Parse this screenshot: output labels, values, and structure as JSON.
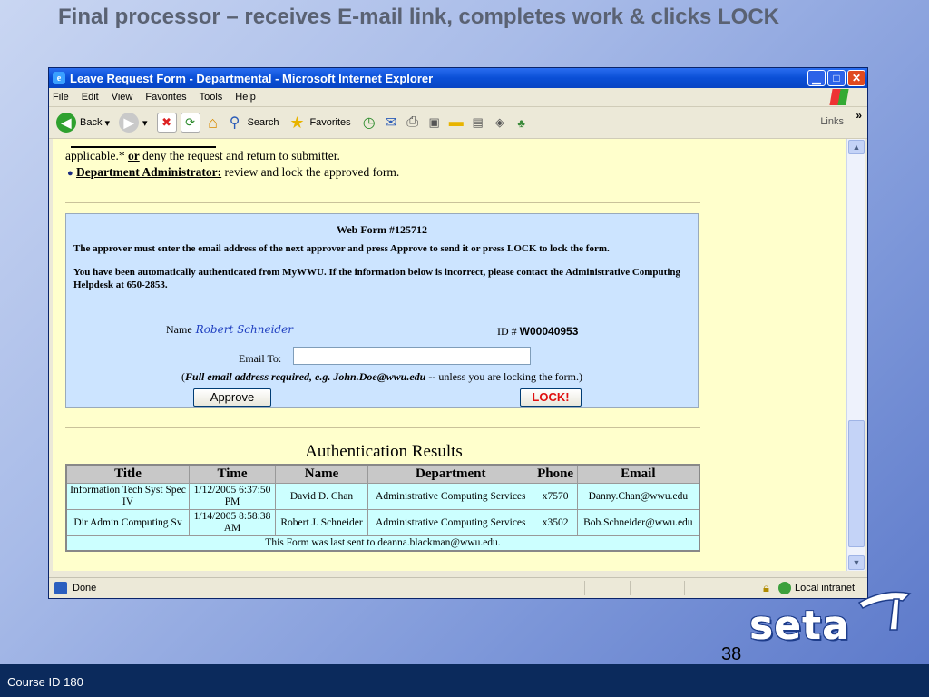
{
  "slide": {
    "title": "Final processor – receives E-mail link, completes work & clicks LOCK",
    "page_number": "38",
    "footer": "Course ID 180",
    "logo": "seta"
  },
  "window": {
    "title": "Leave Request Form - Departmental - Microsoft Internet Explorer",
    "menu": [
      "File",
      "Edit",
      "View",
      "Favorites",
      "Tools",
      "Help"
    ],
    "toolbar": {
      "back": "Back",
      "search": "Search",
      "favorites": "Favorites",
      "links": "Links"
    },
    "status": {
      "text": "Done",
      "zone": "Local intranet"
    }
  },
  "page": {
    "intro_line1": "applicable.* or deny the request and return to submitter.",
    "intro_line1_a": "applicable.* ",
    "intro_line1_or": "or",
    "intro_line1_b": " deny the request and return to submitter.",
    "admin_label": "Department Administrator:",
    "admin_text": " review and lock the approved form.",
    "form": {
      "number": "Web Form #125712",
      "instruction": "The approver must enter the email address of the next approver and press Approve to send it or press LOCK to lock the form.",
      "auth_notice": "You have been automatically authenticated from MyWWU. If the information below is incorrect, please contact the Administrative Computing Helpdesk at 650-2853.",
      "name_label": "Name",
      "name_value": "Robert Schneider",
      "id_label": "ID #",
      "id_value": "W00040953",
      "email_label": "Email To:",
      "email_value": "",
      "note_a": "Full email address required, e.g. John.Doe@wwu.edu",
      "note_b": " -- unless you are locking the form.)",
      "approve_label": "Approve",
      "lock_label": "LOCK!"
    },
    "auth_results": {
      "title": "Authentication Results",
      "headers": [
        "Title",
        "Time",
        "Name",
        "Department",
        "Phone",
        "Email"
      ],
      "rows": [
        [
          "Information Tech Syst Spec IV",
          "1/12/2005 6:37:50 PM",
          "David D. Chan",
          "Administrative Computing Services",
          "x7570",
          "Danny.Chan@wwu.edu"
        ],
        [
          "Dir Admin Computing Sv",
          "1/14/2005 8:58:38 AM",
          "Robert J. Schneider",
          "Administrative Computing Services",
          "x3502",
          "Bob.Schneider@wwu.edu"
        ]
      ],
      "footer": "This Form was last sent to deanna.blackman@wwu.edu."
    }
  }
}
